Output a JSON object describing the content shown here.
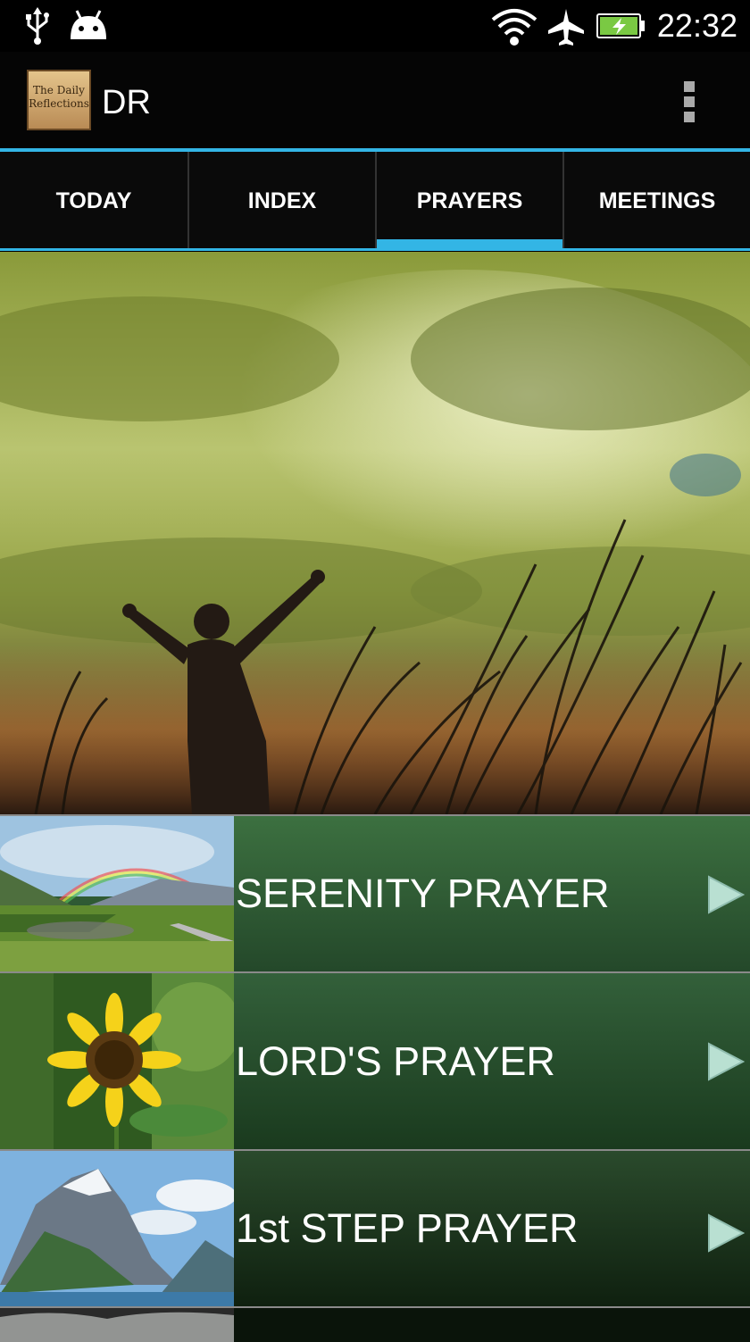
{
  "status_bar": {
    "time": "22:32",
    "left_icons": [
      "usb-icon",
      "android-icon"
    ],
    "right_icons": [
      "wifi-icon",
      "airplane-mode-icon",
      "battery-charging-icon"
    ]
  },
  "action_bar": {
    "logo_text": "The Daily Reflections",
    "title": "DR",
    "menu_icon": "overflow-menu-icon"
  },
  "tabs": [
    {
      "label": "TODAY",
      "active": false
    },
    {
      "label": "INDEX",
      "active": false
    },
    {
      "label": "PRAYERS",
      "active": true
    },
    {
      "label": "MEETINGS",
      "active": false
    }
  ],
  "colors": {
    "accent": "#33b5e5",
    "row_green_top": "#3a6e3c",
    "row_green_bottom": "#1c3c1c"
  },
  "prayers": [
    {
      "label": "SERENITY PRAYER",
      "thumbnail": "rainbow-valley-thumbnail"
    },
    {
      "label": "LORD'S PRAYER",
      "thumbnail": "sunflower-thumbnail"
    },
    {
      "label": "1st STEP PRAYER",
      "thumbnail": "mountain-lake-thumbnail"
    }
  ]
}
